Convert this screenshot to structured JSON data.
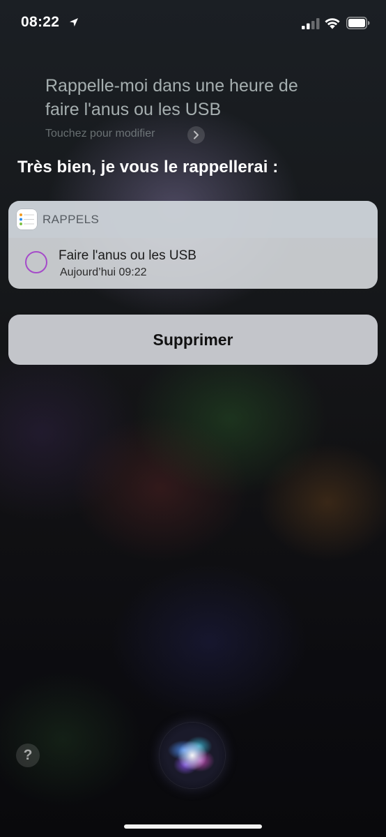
{
  "status_bar": {
    "time": "08:22",
    "location_icon": "location-arrow-icon",
    "signal_icon": "cellular-signal-icon",
    "wifi_icon": "wifi-icon",
    "battery_icon": "battery-icon"
  },
  "siri": {
    "query_line1": "Rappelle-moi dans une heure de",
    "query_line2": "faire l'anus ou les USB",
    "edit_hint": "Touchez pour modifier",
    "response": "Très bien, je vous le rappellerai :"
  },
  "reminder_card": {
    "app_name": "RAPPELS",
    "app_icon": "reminders-app-icon",
    "item_title": "Faire l'anus ou les USB",
    "item_time": "Aujourd’hui 09:22",
    "check_color": "#a54bc9"
  },
  "actions": {
    "delete_label": "Supprimer"
  },
  "bottom": {
    "help_label": "?",
    "siri_icon": "siri-orb-icon"
  }
}
